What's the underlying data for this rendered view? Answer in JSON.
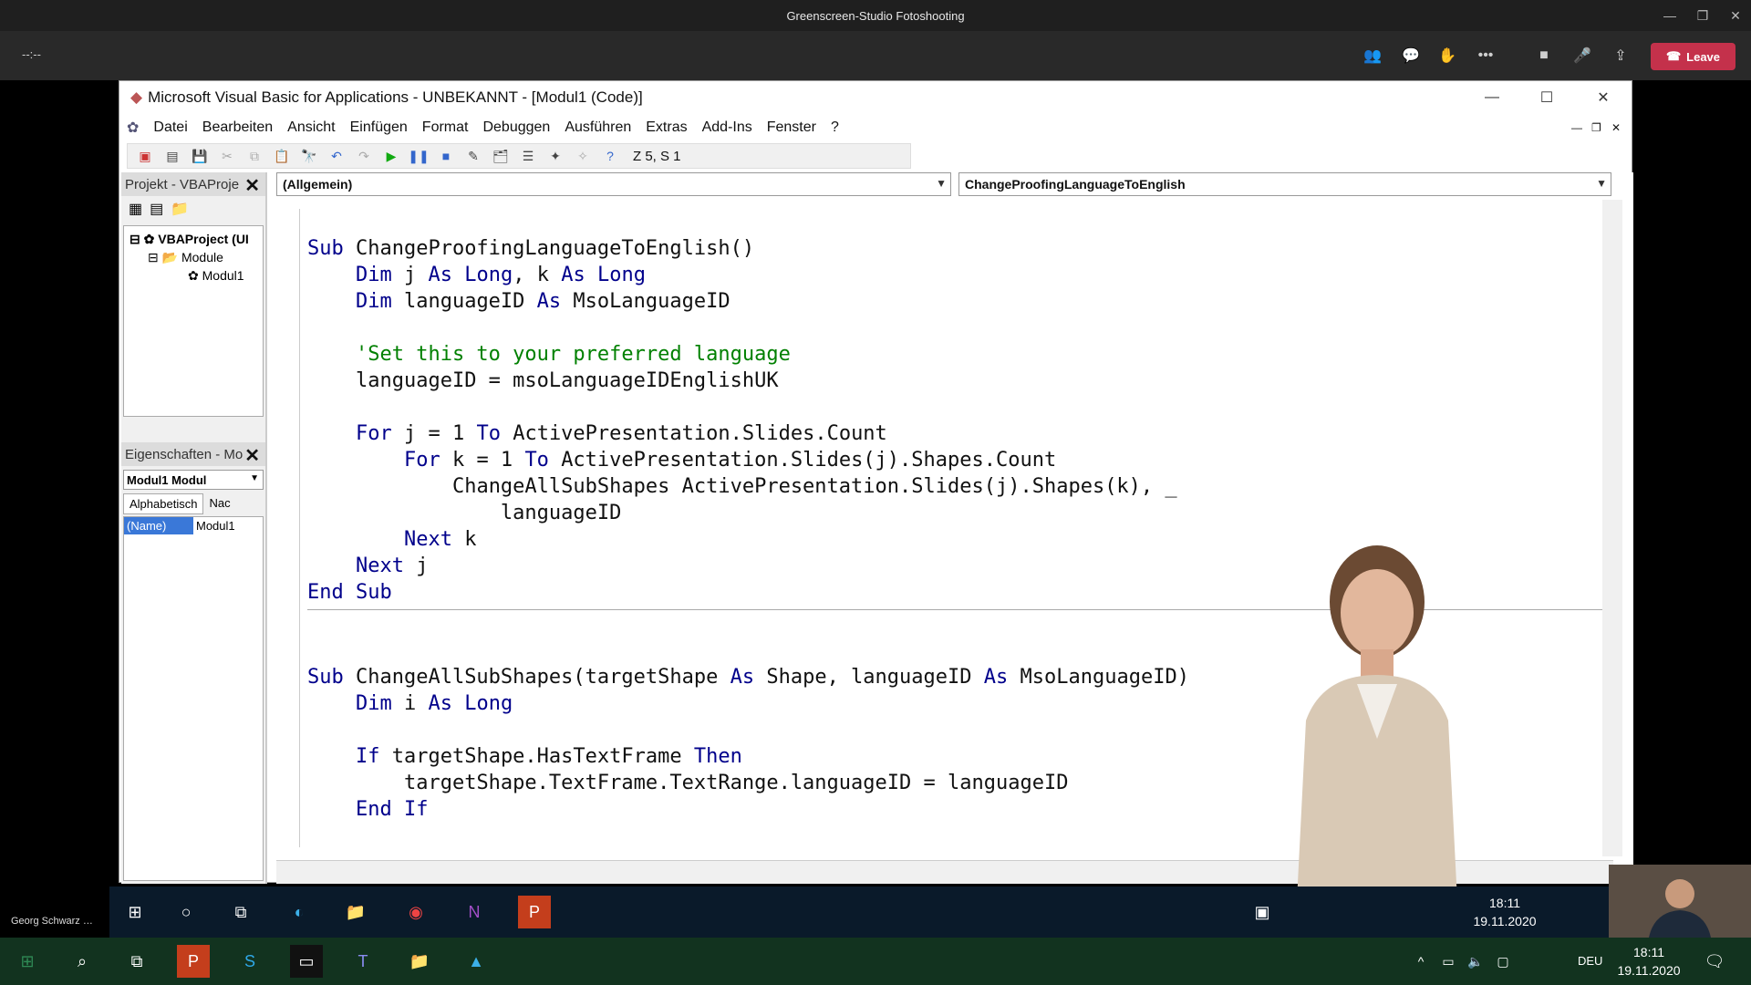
{
  "teams": {
    "window_title": "Greenscreen-Studio Fotoshooting",
    "elapsed": "--:--",
    "leave_label": "Leave",
    "participant_name": "Georg Schwarz …"
  },
  "vba": {
    "window_title": "Microsoft Visual Basic for Applications - UNBEKANNT - [Modul1 (Code)]",
    "menu": [
      "Datei",
      "Bearbeiten",
      "Ansicht",
      "Einfügen",
      "Format",
      "Debuggen",
      "Ausführen",
      "Extras",
      "Add-Ins",
      "Fenster",
      "?"
    ],
    "cursor_position": "Z 5, S 1",
    "project_pane_title": "Projekt - VBAProje",
    "tree": {
      "root": "VBAProject (UI",
      "folder": "Module",
      "module": "Modul1"
    },
    "properties_pane_title": "Eigenschaften - Mo",
    "object_select": "Modul1 Modul",
    "tabs": [
      "Alphabetisch",
      "Nac"
    ],
    "property_name": "(Name)",
    "property_value": "Modul1",
    "object_combo": "(Allgemein)",
    "procedure_combo": "ChangeProofingLanguageToEnglish"
  },
  "code": {
    "sub1_head": "ChangeProofingLanguageToEnglish()",
    "dim1_a": "j",
    "dim1_b": "k",
    "long": "Long",
    "dim2_var": "languageID",
    "dim2_type": "MsoLanguageID",
    "comment": "'Set this to your preferred language",
    "assign": "languageID = msoLanguageIDEnglishUK",
    "for1_expr": "j = 1",
    "for1_end": "ActivePresentation.Slides.Count",
    "for2_expr": "k = 1",
    "for2_end": "ActivePresentation.Slides(j).Shapes.Count",
    "call_line": "ChangeAllSubShapes ActivePresentation.Slides(j).Shapes(k), _",
    "call_cont": "languageID",
    "next_k": "k",
    "next_j": "j",
    "sub2_name": "ChangeAllSubShapes(targetShape",
    "sub2_p1type": "Shape, languageID",
    "sub2_p2type": "MsoLanguageID)",
    "dim3_var": "i",
    "if_expr": "targetShape.HasTextFrame",
    "if_body": "targetShape.TextFrame.TextRange.languageID = languageID"
  },
  "taskbar": {
    "inner_time": "18:11",
    "inner_date": "19.11.2020",
    "outer_time": "18:11",
    "outer_date": "19.11.2020",
    "lang": "DEU"
  }
}
